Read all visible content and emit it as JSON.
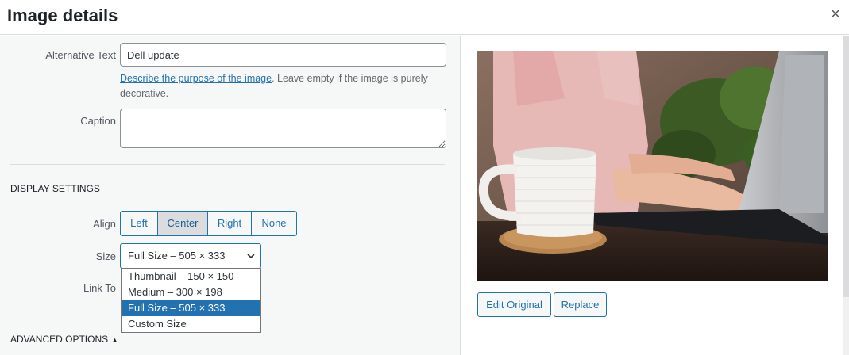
{
  "modal": {
    "title": "Image details",
    "close_icon": "close-icon",
    "close_glyph": "×"
  },
  "alt_text": {
    "label": "Alternative Text",
    "value": "Dell update",
    "help_link": "Describe the purpose of the image",
    "help_rest": ". Leave empty if the image is purely decorative."
  },
  "caption": {
    "label": "Caption",
    "value": ""
  },
  "display_settings": {
    "title": "DISPLAY SETTINGS",
    "align": {
      "label": "Align",
      "options": [
        "Left",
        "Center",
        "Right",
        "None"
      ],
      "selected": "Center"
    },
    "size": {
      "label": "Size",
      "value": "Full Size – 505 × 333",
      "options": [
        "Thumbnail – 150 × 150",
        "Medium – 300 × 198",
        "Full Size – 505 × 333",
        "Custom Size"
      ],
      "selected_index": 2
    },
    "link_to": {
      "label": "Link To"
    }
  },
  "advanced": {
    "label": "ADVANCED OPTIONS",
    "icon": "triangle-up-icon",
    "glyph": "▲"
  },
  "preview": {
    "edit_original": "Edit Original",
    "replace": "Replace",
    "image_icon": "photo-woman-laptop-coffee"
  },
  "colors": {
    "accent": "#2271b1",
    "panel_bg": "#f6f7f7",
    "border": "#dcdcde"
  }
}
